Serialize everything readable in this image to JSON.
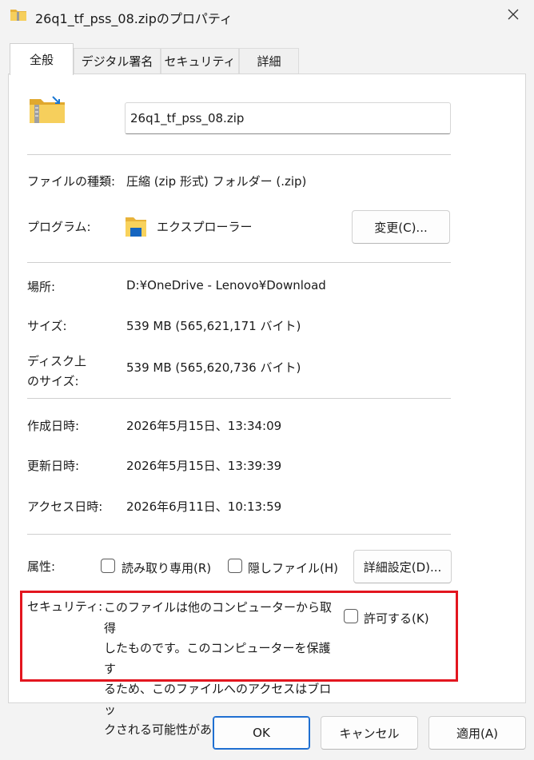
{
  "window": {
    "title": "26q1_tf_pss_08.zipのプロパティ"
  },
  "tabs": [
    {
      "label": "全般"
    },
    {
      "label": "デジタル署名"
    },
    {
      "label": "セキュリティ"
    },
    {
      "label": "詳細"
    }
  ],
  "general": {
    "file_name": "26q1_tf_pss_08.zip",
    "file_type_label": "ファイルの種類:",
    "file_type_value": "圧縮 (zip 形式) フォルダー (.zip)",
    "program_label": "プログラム:",
    "program_value": "エクスプローラー",
    "change_button": "変更(C)...",
    "location_label": "場所:",
    "location_value": "D:¥OneDrive - Lenovo¥Download",
    "size_label": "サイズ:",
    "size_value": "539 MB (565,621,171 バイト)",
    "disk_size_label_line1": "ディスク上",
    "disk_size_label_line2": "のサイズ:",
    "disk_size_value": "539 MB (565,620,736 バイト)",
    "created_label": "作成日時:",
    "created_value": "2026年5月15日、13:34:09",
    "modified_label": "更新日時:",
    "modified_value": "2026年5月15日、13:39:39",
    "accessed_label": "アクセス日時:",
    "accessed_value": "2026年6月11日、10:13:59",
    "attributes_label": "属性:",
    "readonly_label": "読み取り専用(R)",
    "hidden_label": "隠しファイル(H)",
    "advanced_button": "詳細設定(D)...",
    "security_label": "セキュリティ:",
    "security_message_lines": [
      "このファイルは他のコンピューターから取得",
      "したものです。このコンピューターを保護す",
      "るため、このファイルへのアクセスはブロッ",
      "クされる可能性があります。"
    ],
    "unblock_label": "許可する(K)"
  },
  "footer": {
    "ok": "OK",
    "cancel": "キャンセル",
    "apply": "適用(A)"
  },
  "colors": {
    "highlight_border": "#e3161f",
    "ok_border": "#1f6fd1",
    "folder_yellow": "#f2c94c",
    "explorer_blue": "#1565c0"
  }
}
